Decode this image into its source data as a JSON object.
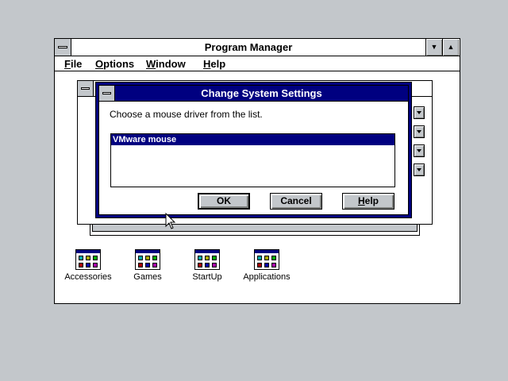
{
  "program_manager": {
    "title": "Program Manager",
    "menu": [
      {
        "accel": "F",
        "rest": "ile"
      },
      {
        "accel": "O",
        "rest": "ptions"
      },
      {
        "accel": "W",
        "rest": "indow"
      },
      {
        "accel": "H",
        "rest": "elp"
      }
    ],
    "minimize_glyph": "▼",
    "maximize_glyph": "▲",
    "icons": [
      {
        "label": "Accessories"
      },
      {
        "label": "Games"
      },
      {
        "label": "StartUp"
      },
      {
        "label": "Applications"
      }
    ]
  },
  "dialog": {
    "title": "Change System Settings",
    "prompt": "Choose a mouse driver from the list.",
    "list_items": [
      "VMware mouse"
    ],
    "buttons": {
      "ok": {
        "accel": "",
        "label": "OK"
      },
      "cancel": {
        "label": "Cancel"
      },
      "help": {
        "accel": "H",
        "rest": "elp"
      }
    }
  },
  "colors": {
    "desktop": "#c3c7cb",
    "active_title": "#000080",
    "window_bg": "#ffffff"
  }
}
